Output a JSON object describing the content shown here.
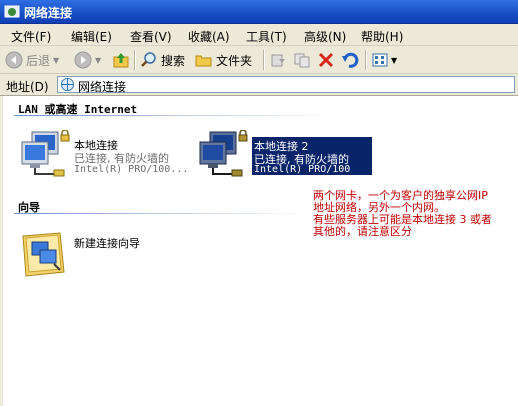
{
  "window": {
    "title": "网络连接"
  },
  "menu": [
    "文件(F)",
    "编辑(E)",
    "查看(V)",
    "收藏(A)",
    "工具(T)",
    "高级(N)",
    "帮助(H)"
  ],
  "toolbar": {
    "back": "后退",
    "search": "搜索",
    "folders": "文件夹"
  },
  "address": {
    "label": "地址(D)",
    "value": "网络连接"
  },
  "sections": {
    "lan": "LAN 或高速 Internet",
    "wizard": "向导"
  },
  "connections": [
    {
      "name": "本地连接",
      "status": "已连接, 有防火墙的",
      "device": "Intel(R) PRO/100..."
    },
    {
      "name": "本地连接 2",
      "status": "已连接, 有防火墙的",
      "device": "Intel(R) PRO/100"
    }
  ],
  "wizard_item": {
    "label": "新建连接向导"
  },
  "annotation": [
    "两个网卡，一个为客户的独享公网IP",
    "地址网络，另外一个内网。",
    "有些服务器上可能是本地连接 3 或者",
    "其他的，请注意区分"
  ],
  "colors": {
    "title_bar": "#1a4fc8",
    "menu_bg": "#ece9d8",
    "selection": "#0a246a",
    "annotation": "#c00000"
  }
}
